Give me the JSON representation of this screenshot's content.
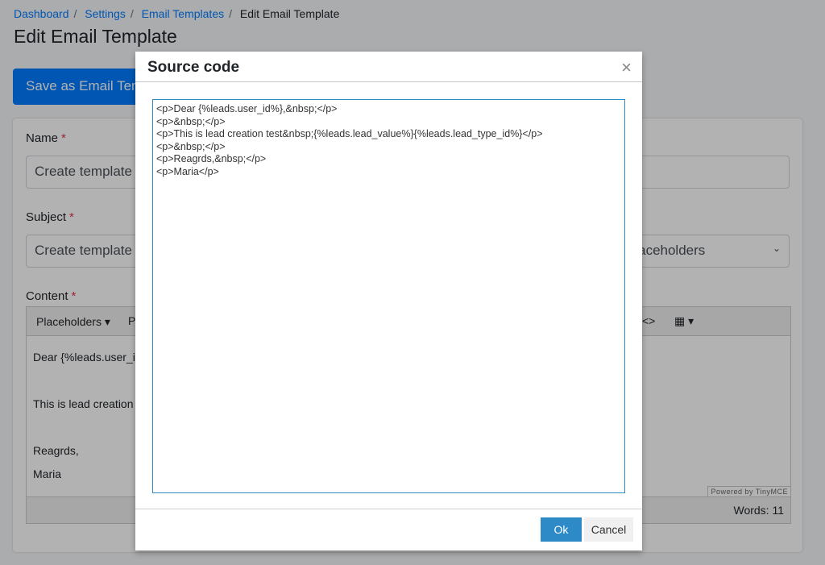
{
  "breadcrumb": [
    "Dashboard",
    "Settings",
    "Email Templates",
    "Edit Email Template"
  ],
  "page_title": "Edit Email Template",
  "save_button": "Save as Email Template",
  "form": {
    "name_label": "Name",
    "subject_label": "Subject",
    "content_label": "Content",
    "required": "*",
    "name_value": "Create template",
    "subject_value": "Create template",
    "placeholders_select": "Placeholders"
  },
  "editor": {
    "toolbar_placeholders": "Placeholders ▾",
    "toolbar_p": "P",
    "code_icon": "<>",
    "table_icon": "▦ ▾",
    "lines": [
      "Dear {%leads.user_id%},",
      "This is lead creation test",
      "Reagrds,",
      "Maria"
    ],
    "powered": "Powered by TinyMCE",
    "words": "Words: 11"
  },
  "modal": {
    "title": "Source code",
    "close": "×",
    "source": "<p>Dear {%leads.user_id%},&nbsp;</p>\n<p>&nbsp;</p>\n<p>This is lead creation test&nbsp;{%leads.lead_value%}{%leads.lead_type_id%}</p>\n<p>&nbsp;</p>\n<p>Reagrds,&nbsp;</p>\n<p>Maria</p>",
    "ok": "Ok",
    "cancel": "Cancel"
  }
}
